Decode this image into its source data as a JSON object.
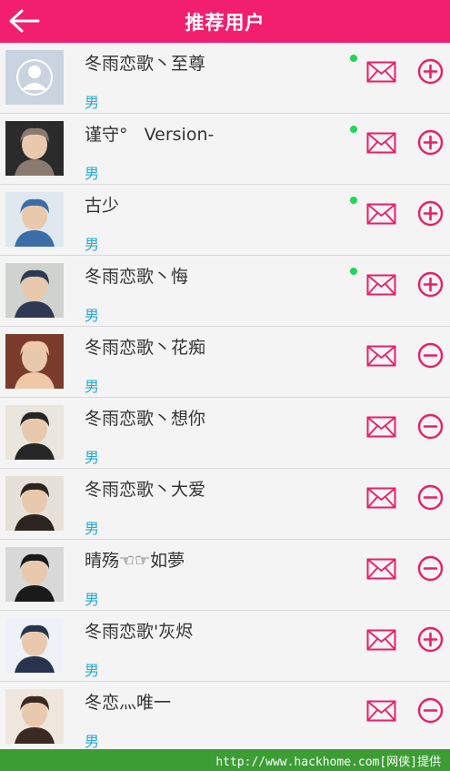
{
  "header": {
    "title": "推荐用户"
  },
  "users": [
    {
      "name": "冬雨恋歌丶至尊",
      "gender": "男",
      "online": true,
      "action": "add",
      "avatar": "default-avatar"
    },
    {
      "name": "谨守°   Version-",
      "gender": "男",
      "online": true,
      "action": "add",
      "avatar": "photo-avatar"
    },
    {
      "name": "古少",
      "gender": "男",
      "online": true,
      "action": "add",
      "avatar": "photo-avatar"
    },
    {
      "name": "冬雨恋歌丶悔",
      "gender": "男",
      "online": true,
      "action": "add",
      "avatar": "photo-avatar"
    },
    {
      "name": "冬雨恋歌丶花痴",
      "gender": "男",
      "online": false,
      "action": "remove",
      "avatar": "photo-avatar"
    },
    {
      "name": "冬雨恋歌丶想你",
      "gender": "男",
      "online": false,
      "action": "remove",
      "avatar": "photo-avatar"
    },
    {
      "name": "冬雨恋歌丶大爱",
      "gender": "男",
      "online": false,
      "action": "remove",
      "avatar": "photo-avatar"
    },
    {
      "name": "晴殇☜☞如夢",
      "gender": "男",
      "online": false,
      "action": "remove",
      "avatar": "photo-avatar"
    },
    {
      "name": "冬雨恋歌'灰烬",
      "gender": "男",
      "online": false,
      "action": "add",
      "avatar": "photo-avatar"
    },
    {
      "name": "冬恋灬唯一",
      "gender": "男",
      "online": false,
      "action": "remove",
      "avatar": "photo-avatar"
    }
  ],
  "footer": {
    "text": "http://www.hackhome.com[网侠]提供"
  },
  "colors": {
    "header": "#f21f6e",
    "accent": "#e8206a",
    "online": "#21d45a",
    "gender": "#28a8d6",
    "footer": "#3d9d35"
  }
}
